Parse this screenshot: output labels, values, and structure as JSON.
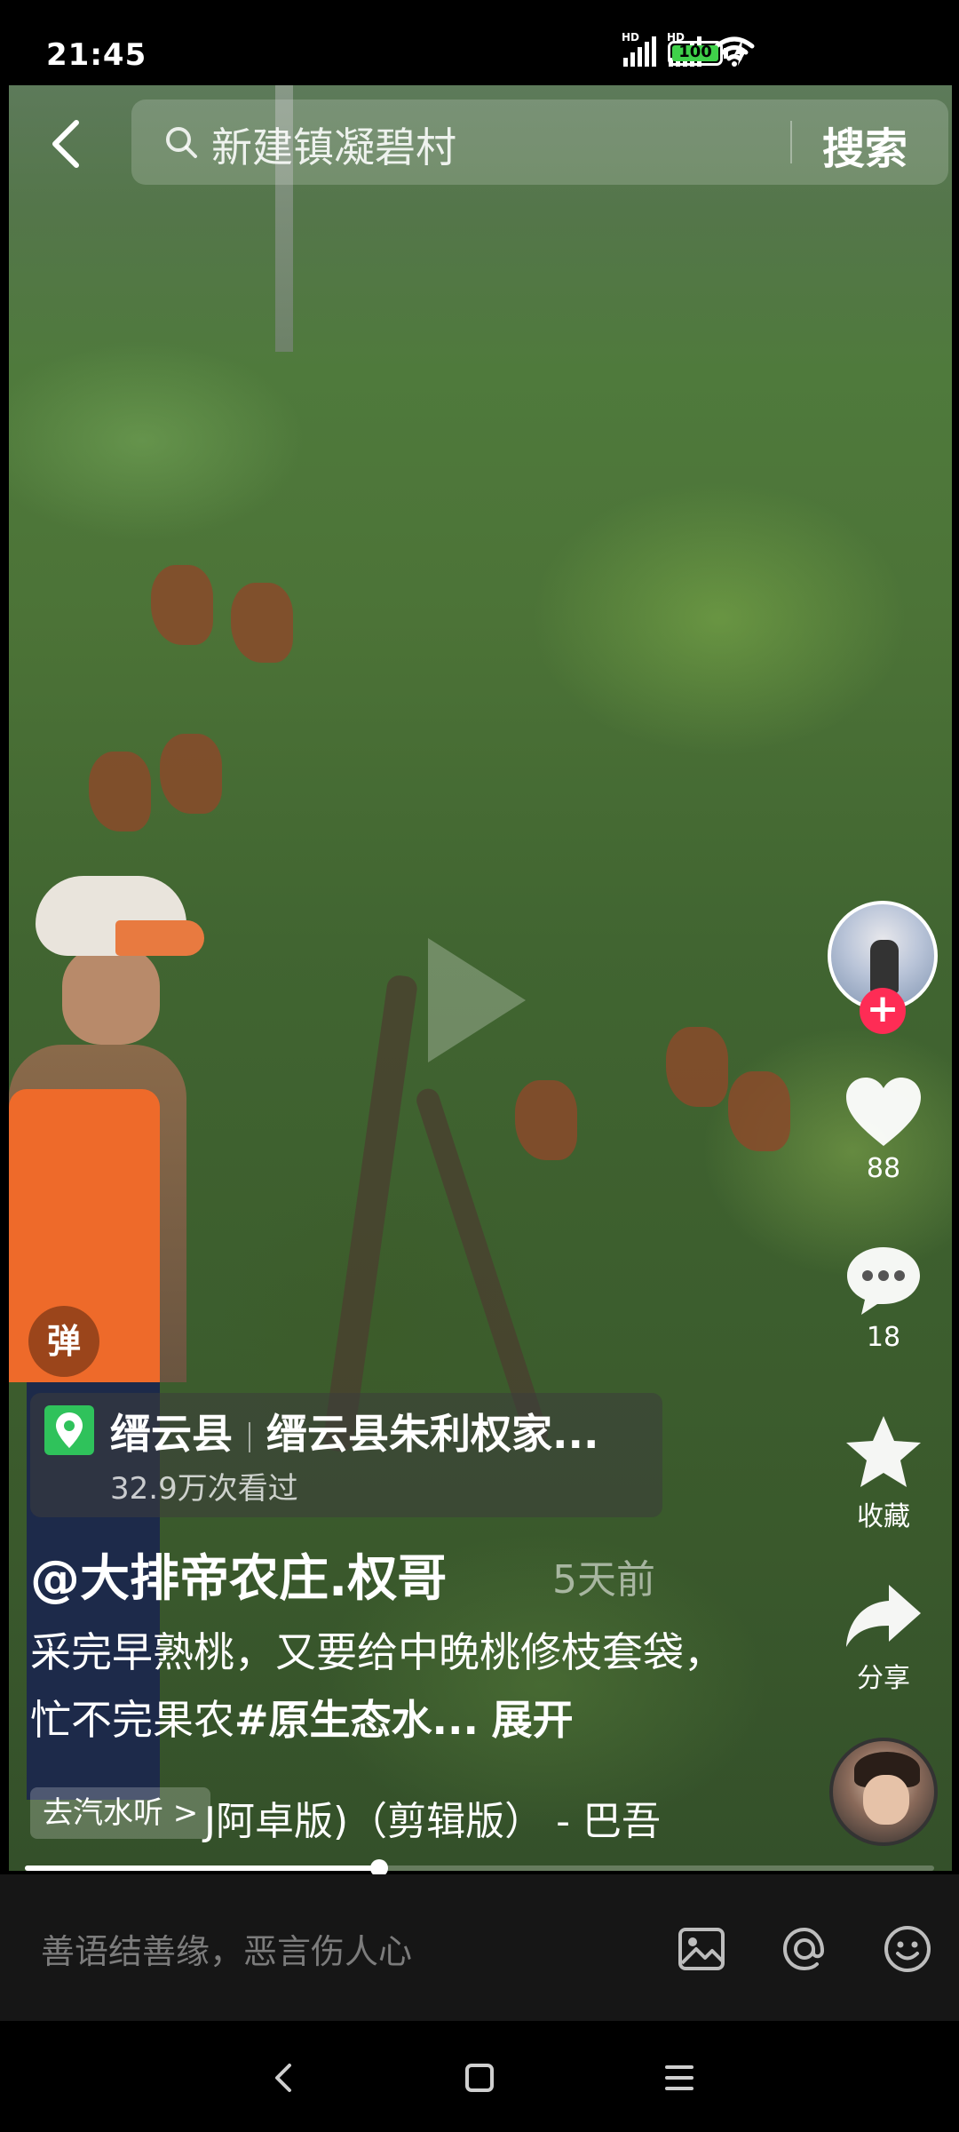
{
  "status_bar": {
    "time": "21:45",
    "signal1_label": "HD",
    "signal2_label": "HD",
    "battery": "100"
  },
  "search": {
    "query": "新建镇凝碧村",
    "button": "搜索"
  },
  "rail": {
    "likes": "88",
    "comments": "18",
    "favorite_label": "收藏",
    "share_label": "分享"
  },
  "danmu_label": "弹",
  "location": {
    "county": "缙云县",
    "place": "缙云县朱利权家...",
    "views": "32.9万次看过"
  },
  "author": {
    "name": "@大排帝农庄.权哥",
    "time": "5天前"
  },
  "caption": {
    "text": "采完早熟桃，又要给中晚桃修枝套袋，忙不完果农",
    "hashtag": "#原生态水...",
    "expand": "展开"
  },
  "music": {
    "tag": "去汽水听 >",
    "title": "J阿卓版)（剪辑版） - 巴吾"
  },
  "progress": {
    "fraction": 0.39
  },
  "comment": {
    "placeholder": "善语结善缘，恶言伤人心"
  },
  "colors": {
    "follow": "#fe2c55",
    "location_pin": "#2fc25b",
    "battery_fill": "#3fd14a"
  }
}
